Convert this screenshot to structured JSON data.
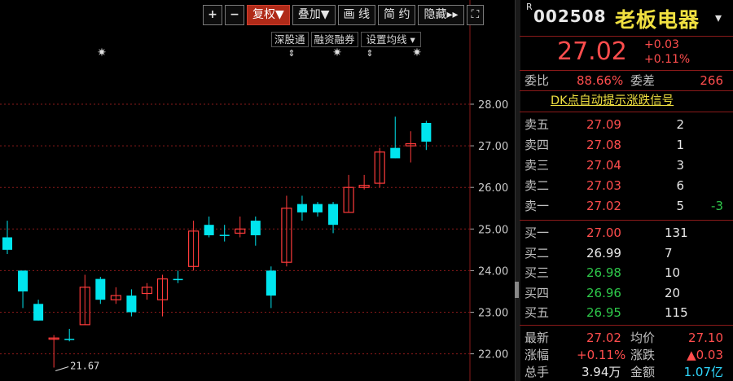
{
  "toolbar": {
    "zoom_in": "+",
    "zoom_out": "−",
    "restore": "复权▼",
    "overlay": "叠加▼",
    "draw": "画 线",
    "simple": "简 约",
    "hide": "隐藏▸▸",
    "fullscreen": "⛶"
  },
  "subbar": {
    "shenzhen_connect": "深股通",
    "margin": "融资融券",
    "ma_settings": "设置均线 ▾"
  },
  "chart_data": {
    "type": "candlestick",
    "y_ticks": [
      "28.00",
      "27.00",
      "26.00",
      "25.00",
      "24.00",
      "23.00",
      "22.00"
    ],
    "ylim": [
      21.4,
      28.6
    ],
    "low_annotation": "21.67",
    "candles": [
      {
        "o": 24.8,
        "h": 25.2,
        "l": 24.4,
        "c": 24.5,
        "up": false
      },
      {
        "o": 24.0,
        "h": 24.0,
        "l": 23.1,
        "c": 23.5,
        "up": false
      },
      {
        "o": 23.2,
        "h": 23.3,
        "l": 22.8,
        "c": 22.8,
        "up": false
      },
      {
        "o": 22.38,
        "h": 22.45,
        "l": 21.67,
        "c": 22.38,
        "up": true
      },
      {
        "o": 22.36,
        "h": 22.6,
        "l": 22.3,
        "c": 22.36,
        "up": false
      },
      {
        "o": 22.7,
        "h": 23.9,
        "l": 22.7,
        "c": 23.6,
        "up": true
      },
      {
        "o": 23.8,
        "h": 23.85,
        "l": 23.2,
        "c": 23.3,
        "up": false
      },
      {
        "o": 23.3,
        "h": 23.6,
        "l": 23.2,
        "c": 23.4,
        "up": true
      },
      {
        "o": 23.4,
        "h": 23.55,
        "l": 22.9,
        "c": 23.0,
        "up": false
      },
      {
        "o": 23.45,
        "h": 23.7,
        "l": 23.3,
        "c": 23.6,
        "up": true
      },
      {
        "o": 23.3,
        "h": 23.9,
        "l": 22.9,
        "c": 23.8,
        "up": true
      },
      {
        "o": 23.8,
        "h": 24.0,
        "l": 23.7,
        "c": 23.8,
        "up": false
      },
      {
        "o": 24.1,
        "h": 25.2,
        "l": 24.0,
        "c": 24.95,
        "up": true
      },
      {
        "o": 25.1,
        "h": 25.3,
        "l": 24.8,
        "c": 24.85,
        "up": false
      },
      {
        "o": 24.86,
        "h": 25.1,
        "l": 24.7,
        "c": 24.86,
        "up": false
      },
      {
        "o": 24.9,
        "h": 25.3,
        "l": 24.8,
        "c": 25.0,
        "up": true
      },
      {
        "o": 25.2,
        "h": 25.3,
        "l": 24.6,
        "c": 24.85,
        "up": false
      },
      {
        "o": 24.0,
        "h": 24.1,
        "l": 23.1,
        "c": 23.4,
        "up": false
      },
      {
        "o": 24.2,
        "h": 25.8,
        "l": 24.1,
        "c": 25.5,
        "up": true
      },
      {
        "o": 25.6,
        "h": 25.8,
        "l": 25.2,
        "c": 25.4,
        "up": false
      },
      {
        "o": 25.6,
        "h": 25.65,
        "l": 25.3,
        "c": 25.4,
        "up": false
      },
      {
        "o": 25.6,
        "h": 25.65,
        "l": 24.9,
        "c": 25.1,
        "up": false
      },
      {
        "o": 25.4,
        "h": 26.3,
        "l": 25.4,
        "c": 26.0,
        "up": true
      },
      {
        "o": 26.0,
        "h": 26.3,
        "l": 25.95,
        "c": 26.05,
        "up": true
      },
      {
        "o": 26.1,
        "h": 26.95,
        "l": 26.0,
        "c": 26.85,
        "up": true
      },
      {
        "o": 26.95,
        "h": 27.7,
        "l": 26.7,
        "c": 26.7,
        "up": false
      },
      {
        "o": 27.0,
        "h": 27.35,
        "l": 26.6,
        "c": 27.05,
        "up": true
      },
      {
        "o": 27.55,
        "h": 27.6,
        "l": 26.9,
        "c": 27.1,
        "up": false
      }
    ]
  },
  "stock": {
    "prefix": "R",
    "code": "002508",
    "name": "老板电器",
    "price": "27.02",
    "change": "+0.03",
    "change_pct": "+0.11%"
  },
  "committee": {
    "ratio_label": "委比",
    "ratio": "88.66%",
    "diff_label": "委差",
    "diff": "266"
  },
  "signal_link": "DK点自动提示涨跌信号",
  "asks": [
    {
      "label": "卖五",
      "price": "27.09",
      "vol": "2",
      "delta": ""
    },
    {
      "label": "卖四",
      "price": "27.08",
      "vol": "1",
      "delta": ""
    },
    {
      "label": "卖三",
      "price": "27.04",
      "vol": "3",
      "delta": ""
    },
    {
      "label": "卖二",
      "price": "27.03",
      "vol": "6",
      "delta": ""
    },
    {
      "label": "卖一",
      "price": "27.02",
      "vol": "5",
      "delta": "-3"
    }
  ],
  "bids": [
    {
      "label": "买一",
      "price": "27.00",
      "vol": "131",
      "color": "red"
    },
    {
      "label": "买二",
      "price": "26.99",
      "vol": "7",
      "color": "white"
    },
    {
      "label": "买三",
      "price": "26.98",
      "vol": "10",
      "color": "green"
    },
    {
      "label": "买四",
      "price": "26.96",
      "vol": "20",
      "color": "green"
    },
    {
      "label": "买五",
      "price": "26.95",
      "vol": "115",
      "color": "green"
    }
  ],
  "stats": {
    "latest_label": "最新",
    "latest": "27.02",
    "avg_label": "均价",
    "avg": "27.10",
    "chg_pct_label": "涨幅",
    "chg_pct": "+0.11%",
    "chg_label": "涨跌",
    "chg": "▲0.03",
    "volume_label": "总手",
    "volume": "3.94万",
    "amount_label": "金额",
    "amount": "1.07亿"
  },
  "colors": {
    "up": "#ff3b3b",
    "down": "#00e5ee",
    "grid": "#8a1a1a",
    "axis_text": "#c8c8c8"
  }
}
